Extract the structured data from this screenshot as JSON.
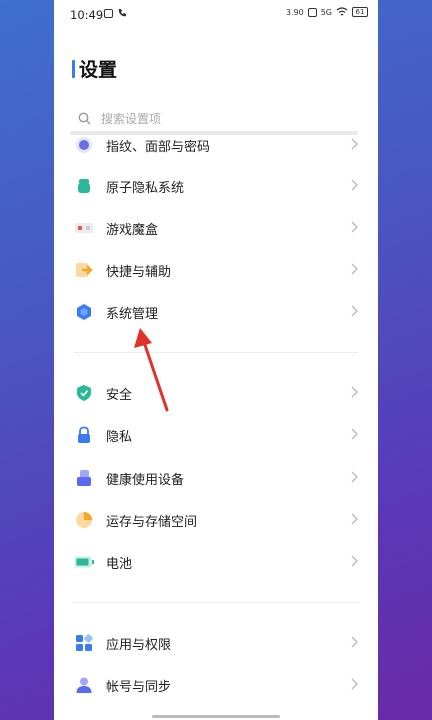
{
  "status_bar": {
    "time": "10:49",
    "net_speed": "3.90",
    "network": "5G",
    "battery": "61"
  },
  "page": {
    "title": "设置"
  },
  "search": {
    "placeholder": "搜索设置项"
  },
  "group1": [
    {
      "label": "指纹、面部与密码",
      "icon": "fingerprint-icon",
      "color": "#6b6fe0"
    },
    {
      "label": "原子隐私系统",
      "icon": "privacy-system-icon",
      "color": "#2bb89a"
    },
    {
      "label": "游戏魔盒",
      "icon": "game-box-icon",
      "color": "#e05a5a"
    },
    {
      "label": "快捷与辅助",
      "icon": "shortcut-icon",
      "color": "#f5a623"
    },
    {
      "label": "系统管理",
      "icon": "system-management-icon",
      "color": "#3a7bf0"
    }
  ],
  "group2": [
    {
      "label": "安全",
      "icon": "security-shield-icon",
      "color": "#2bb89a"
    },
    {
      "label": "隐私",
      "icon": "privacy-lock-icon",
      "color": "#3a7bf0"
    },
    {
      "label": "健康使用设备",
      "icon": "health-usage-icon",
      "color": "#5a6af0"
    },
    {
      "label": "运存与存储空间",
      "icon": "storage-icon",
      "color": "#f5a623"
    },
    {
      "label": "电池",
      "icon": "battery-icon",
      "color": "#2bb89a"
    }
  ],
  "group3": [
    {
      "label": "应用与权限",
      "icon": "apps-permissions-icon",
      "color": "#3a7bf0"
    },
    {
      "label": "帐号与同步",
      "icon": "account-sync-icon",
      "color": "#5a6af0"
    }
  ]
}
